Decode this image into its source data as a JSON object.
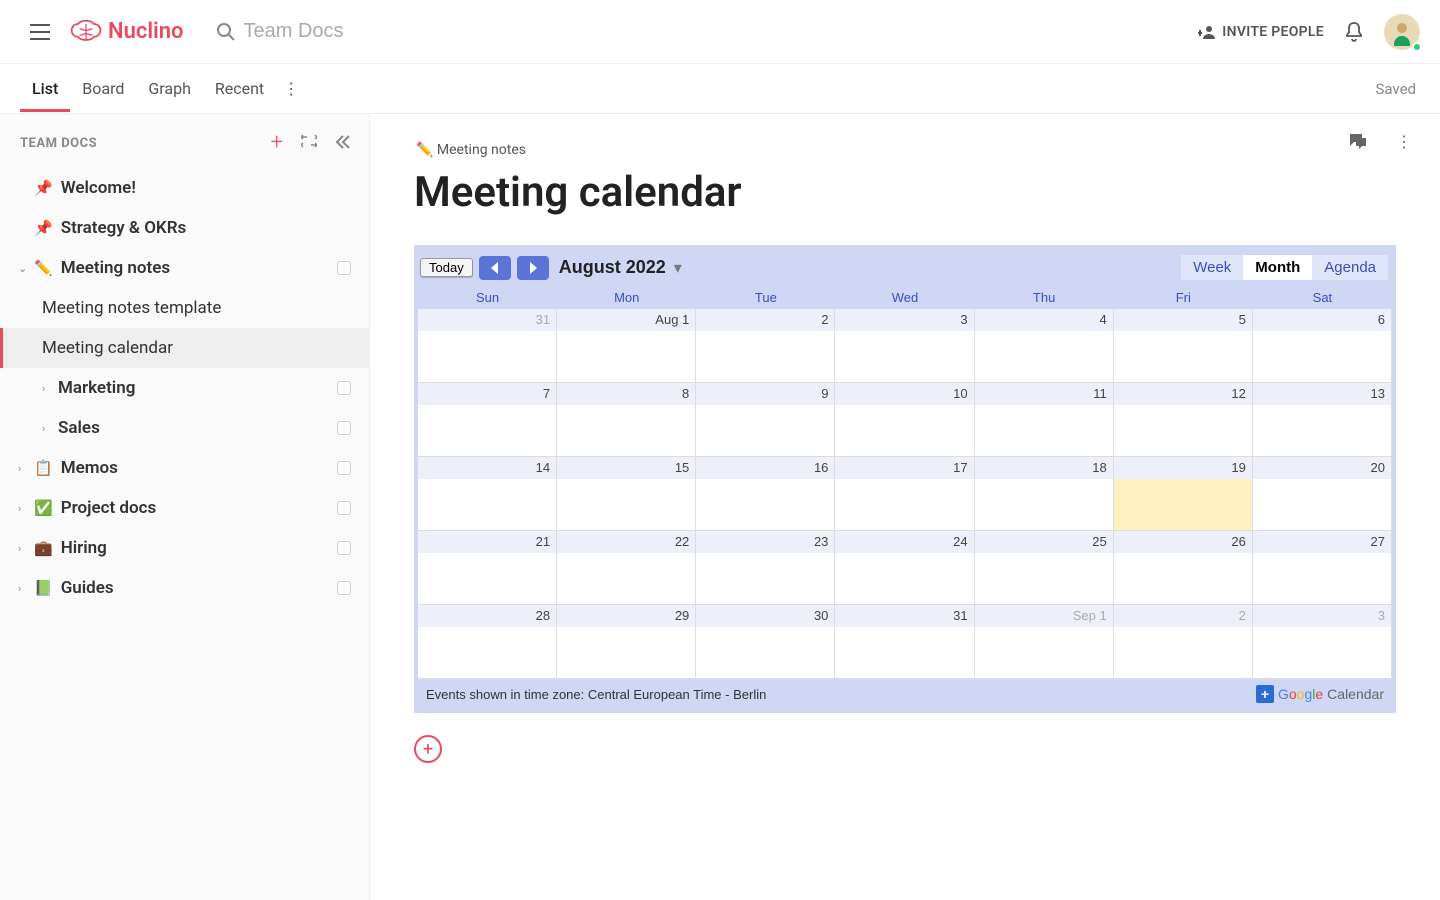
{
  "brand": {
    "name": "Nuclino"
  },
  "search": {
    "placeholder": "Team Docs"
  },
  "header": {
    "invite_label": "INVITE PEOPLE",
    "saved_label": "Saved"
  },
  "tabs": [
    "List",
    "Board",
    "Graph",
    "Recent"
  ],
  "active_tab_index": 0,
  "sidebar": {
    "title": "TEAM DOCS",
    "items": [
      {
        "icon": "📌",
        "label": "Welcome!",
        "bold": true
      },
      {
        "icon": "📌",
        "label": "Strategy & OKRs",
        "bold": true
      },
      {
        "icon": "✏️",
        "label": "Meeting notes",
        "bold": true,
        "caret": "down",
        "check": true
      },
      {
        "label": "Meeting notes template",
        "indent": 1
      },
      {
        "label": "Meeting calendar",
        "indent": 1,
        "selected": true
      },
      {
        "label": "Marketing",
        "bold": true,
        "caret": "right",
        "indent": 1,
        "check": true
      },
      {
        "label": "Sales",
        "bold": true,
        "caret": "right",
        "indent": 1,
        "check": true
      },
      {
        "icon": "📋",
        "label": "Memos",
        "bold": true,
        "caret": "right",
        "check": true
      },
      {
        "icon": "✅",
        "label": "Project docs",
        "bold": true,
        "caret": "right",
        "check": true
      },
      {
        "icon": "💼",
        "label": "Hiring",
        "bold": true,
        "caret": "right",
        "check": true
      },
      {
        "icon": "📗",
        "label": "Guides",
        "bold": true,
        "caret": "right",
        "check": true
      }
    ]
  },
  "doc": {
    "breadcrumb": "✏️ Meeting notes",
    "title": "Meeting calendar"
  },
  "calendar": {
    "today_label": "Today",
    "month_label": "August 2022",
    "views": [
      "Week",
      "Month",
      "Agenda"
    ],
    "active_view": "Month",
    "day_headers": [
      "Sun",
      "Mon",
      "Tue",
      "Wed",
      "Thu",
      "Fri",
      "Sat"
    ],
    "weeks": [
      [
        {
          "n": "31",
          "muted": true
        },
        {
          "n": "Aug 1"
        },
        {
          "n": "2"
        },
        {
          "n": "3"
        },
        {
          "n": "4"
        },
        {
          "n": "5"
        },
        {
          "n": "6"
        }
      ],
      [
        {
          "n": "7"
        },
        {
          "n": "8"
        },
        {
          "n": "9"
        },
        {
          "n": "10"
        },
        {
          "n": "11"
        },
        {
          "n": "12"
        },
        {
          "n": "13"
        }
      ],
      [
        {
          "n": "14"
        },
        {
          "n": "15"
        },
        {
          "n": "16"
        },
        {
          "n": "17"
        },
        {
          "n": "18"
        },
        {
          "n": "19",
          "today": true
        },
        {
          "n": "20"
        }
      ],
      [
        {
          "n": "21"
        },
        {
          "n": "22"
        },
        {
          "n": "23"
        },
        {
          "n": "24"
        },
        {
          "n": "25"
        },
        {
          "n": "26"
        },
        {
          "n": "27"
        }
      ],
      [
        {
          "n": "28"
        },
        {
          "n": "29"
        },
        {
          "n": "30"
        },
        {
          "n": "31"
        },
        {
          "n": "Sep 1",
          "muted": true
        },
        {
          "n": "2",
          "muted": true
        },
        {
          "n": "3",
          "muted": true
        }
      ]
    ],
    "footer": "Events shown in time zone: Central European Time - Berlin",
    "gcal_label": "Calendar"
  }
}
